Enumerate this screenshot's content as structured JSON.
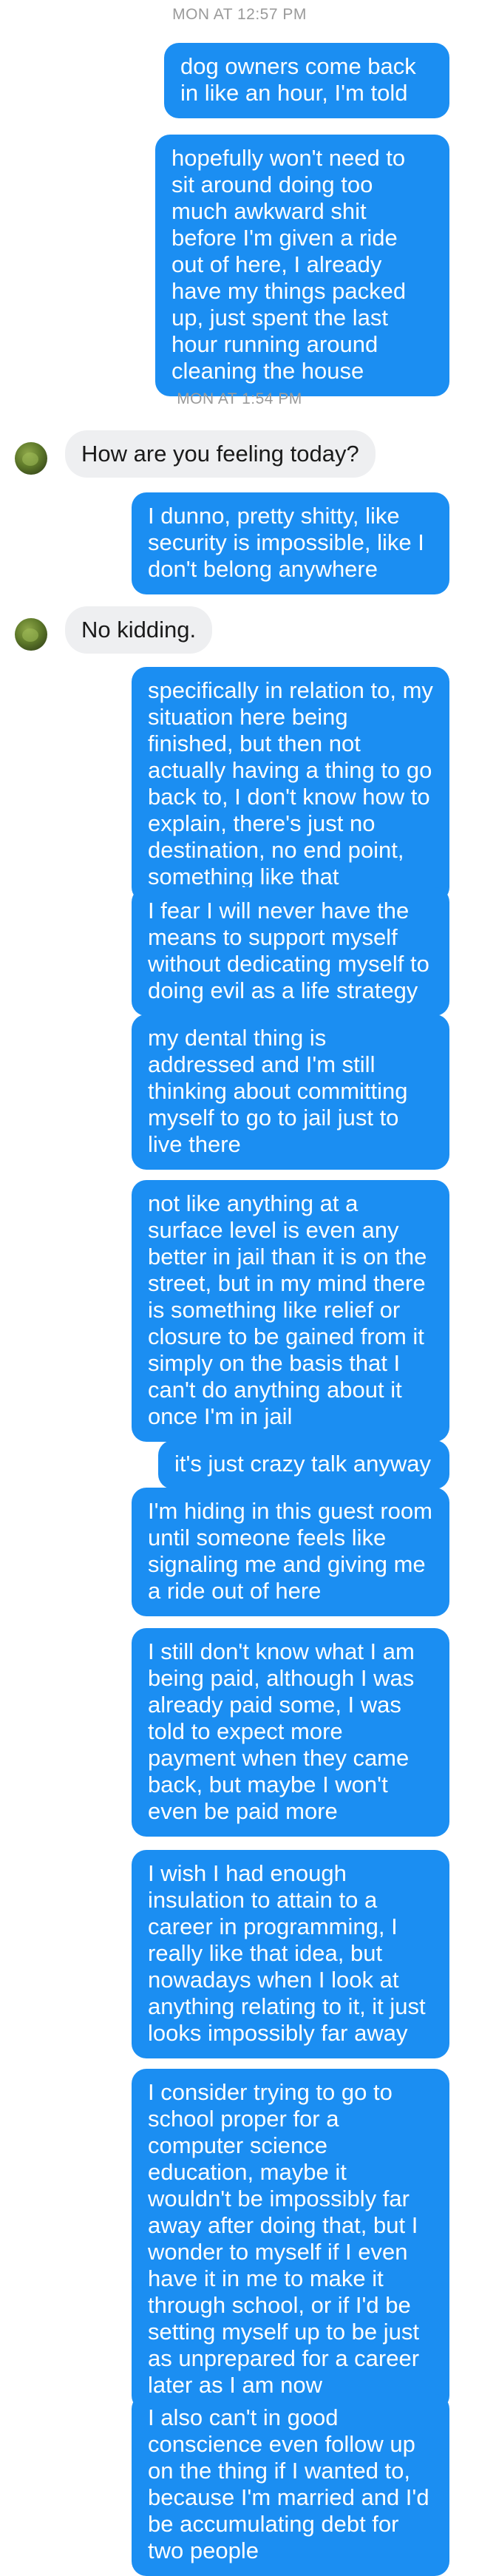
{
  "timestamps": [
    "MON AT 12:57 PM",
    "MON AT 1:54 PM"
  ],
  "contact": {
    "avatar_icon": "contact-avatar"
  },
  "colors": {
    "outgoing_bubble": "#1b8ef2",
    "incoming_bubble": "#eeeff1",
    "timestamp_text": "#9a9a9a"
  },
  "messages": [
    "dog owners come back in like an hour, I'm told",
    "hopefully won't need to sit around doing too much awkward shit before I'm given a ride out of here, I already have my things packed up, just spent the last hour running around cleaning the house",
    "How are you feeling today?",
    "I dunno, pretty shitty, like security is impossible, like I don't belong anywhere",
    "No kidding.",
    "specifically in relation to, my situation here being finished, but then not actually having a thing to go back to, I don't know how to explain, there's just no destination, no end point, something like that",
    "I fear I will never have the means to support myself without dedicating myself to doing evil as a life strategy",
    "my dental thing is addressed and I'm still thinking about committing myself to go to jail just to live there",
    "not like anything at a surface level is even any better in jail than it is on the street, but in my mind there is something like relief or closure to be gained from it simply on the basis that I can't do anything about it once I'm in jail",
    "it's just crazy talk anyway",
    "I'm hiding in this guest room until someone feels like signaling me and giving me a ride out of here",
    "I still don't know what I am being paid, although I was already paid some, I was told to expect more payment when they came back, but maybe I won't even be paid more",
    "I wish I had enough insulation to attain to a career in programming, I really like that idea, but nowadays when I look at anything relating to it, it just looks impossibly far away",
    "I consider trying to go to school proper for a computer science education, maybe it wouldn't be impossibly far away after doing that, but I wonder to myself if I even have it in me to make it through school, or if I'd be setting myself up to be just as unprepared for a career later as I am now",
    "I also can't in good conscience even follow up on the thing if I wanted to, because I'm married and I'd be accumulating debt for two people"
  ]
}
